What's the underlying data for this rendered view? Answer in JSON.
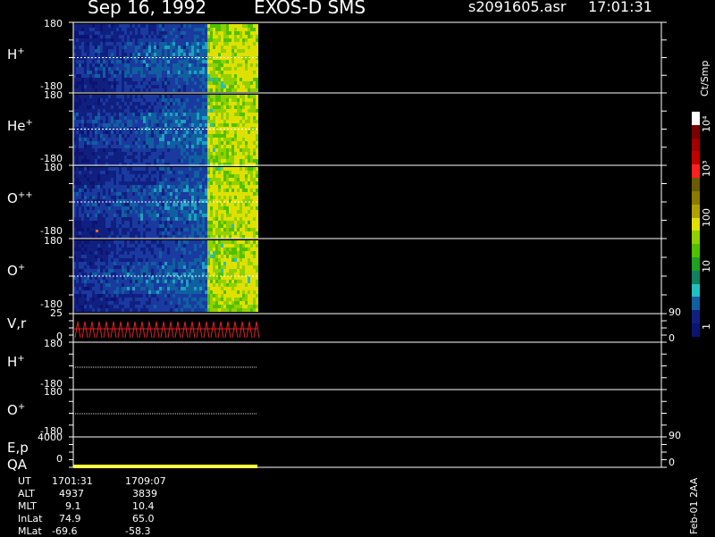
{
  "header": {
    "date": "Sep 16, 1992",
    "instrument": "EXOS-D SMS",
    "file": "s2091605.asr",
    "time": "17:01:31"
  },
  "panels": [
    {
      "label": "H",
      "sup": "+",
      "top": "180",
      "bottom": "-180"
    },
    {
      "label": "He",
      "sup": "+",
      "top": "180",
      "bottom": "-180"
    },
    {
      "label": "O",
      "sup": "++",
      "top": "180",
      "bottom": "-180"
    },
    {
      "label": "O",
      "sup": "+",
      "top": "180",
      "bottom": "-180"
    }
  ],
  "vr_panel": {
    "label": "V,r",
    "left_top": "25",
    "left_bottom": "0",
    "right_top": "90",
    "right_bottom": "0"
  },
  "line_panels": [
    {
      "label": "H",
      "sup": "+",
      "top": "180",
      "bottom": "-180"
    },
    {
      "label": "O",
      "sup": "+",
      "top": "180",
      "bottom": "-180"
    }
  ],
  "ep_panel": {
    "label": "E,p",
    "qa": "QA",
    "left_top": "4000",
    "left_bottom": "0",
    "right_top": "90",
    "right_bottom": "0"
  },
  "colorbar": {
    "unit": "Ct/Smp",
    "ticks": [
      "10⁴",
      "10³",
      "100",
      "10",
      "1"
    ],
    "colors": [
      "#ffffff",
      "#7a0000",
      "#a00000",
      "#c00000",
      "#ff2020",
      "#6a5a00",
      "#8a7a00",
      "#b0a000",
      "#e0e000",
      "#90d000",
      "#50c000",
      "#20a020",
      "#108060",
      "#20c0c0",
      "#1060a0",
      "#102080",
      "#0c1470"
    ]
  },
  "ephemeris": {
    "rows": [
      "UT",
      "ALT",
      "MLT",
      "InLat",
      "MLat"
    ],
    "columns": [
      [
        "1701:31",
        "4937",
        "9.1",
        "74.9",
        "-69.6"
      ],
      [
        "1709:07",
        "3839",
        "10.4",
        "65.0",
        "-58.3"
      ]
    ]
  },
  "footer": {
    "stamp": "Feb-01 2AA"
  }
}
